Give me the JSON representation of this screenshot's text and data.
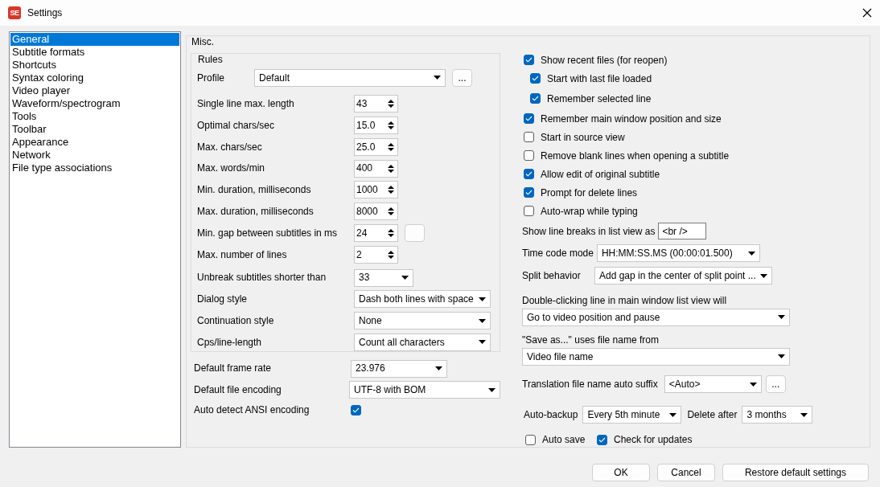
{
  "window": {
    "icon_text": "SE",
    "title": "Settings"
  },
  "sidebar": {
    "items": [
      {
        "label": "General",
        "selected": true
      },
      {
        "label": "Subtitle formats",
        "selected": false
      },
      {
        "label": "Shortcuts",
        "selected": false
      },
      {
        "label": "Syntax coloring",
        "selected": false
      },
      {
        "label": "Video player",
        "selected": false
      },
      {
        "label": "Waveform/spectrogram",
        "selected": false
      },
      {
        "label": "Tools",
        "selected": false
      },
      {
        "label": "Toolbar",
        "selected": false
      },
      {
        "label": "Appearance",
        "selected": false
      },
      {
        "label": "Network",
        "selected": false
      },
      {
        "label": "File type associations",
        "selected": false
      }
    ]
  },
  "misc": {
    "title": "Misc.",
    "rules": {
      "title": "Rules",
      "profile": {
        "label": "Profile",
        "value": "Default",
        "button": "..."
      },
      "fields": [
        {
          "kind": "spinner",
          "label": "Single line max. length",
          "value": "43"
        },
        {
          "kind": "spinner",
          "label": "Optimal chars/sec",
          "value": "15.0"
        },
        {
          "kind": "spinner",
          "label": "Max. chars/sec",
          "value": "25.0"
        },
        {
          "kind": "spinner",
          "label": "Max. words/min",
          "value": "400"
        },
        {
          "kind": "spinner",
          "label": "Min. duration, milliseconds",
          "value": "1000"
        },
        {
          "kind": "spinner",
          "label": "Max. duration, milliseconds",
          "value": "8000"
        },
        {
          "kind": "spinner",
          "label": "Min. gap between subtitles in ms",
          "value": "24",
          "side_button": true
        },
        {
          "kind": "spinner",
          "label": "Max. number of lines",
          "value": "2"
        },
        {
          "kind": "combo",
          "label": "Unbreak subtitles shorter than",
          "value": "33"
        },
        {
          "kind": "combo",
          "label": "Dialog style",
          "value": "Dash both lines with space"
        },
        {
          "kind": "combo",
          "label": "Continuation style",
          "value": "None"
        },
        {
          "kind": "combo",
          "label": "Cps/line-length",
          "value": "Count all characters"
        }
      ]
    },
    "general_fields": [
      {
        "kind": "combo",
        "label": "Default frame rate",
        "value": "23.976"
      },
      {
        "kind": "combo",
        "label": "Default file encoding",
        "value": "UTF-8 with BOM"
      },
      {
        "kind": "checkbox",
        "label": "Auto detect ANSI encoding",
        "checked": true
      }
    ],
    "options": [
      {
        "label": "Show recent files (for reopen)",
        "checked": true,
        "children": [
          {
            "label": "Start with last file loaded",
            "checked": true
          },
          {
            "label": "Remember selected line",
            "checked": true
          }
        ]
      },
      {
        "label": "Remember main window position and size",
        "checked": true
      },
      {
        "label": "Start in source view",
        "checked": false
      },
      {
        "label": "Remove blank lines when opening a subtitle",
        "checked": false
      },
      {
        "label": "Allow edit of original subtitle",
        "checked": true
      },
      {
        "label": "Prompt for delete lines",
        "checked": true
      },
      {
        "label": "Auto-wrap while typing",
        "checked": false
      }
    ],
    "line_breaks": {
      "label": "Show line breaks in list view as",
      "value": "<br />"
    },
    "time_code_mode": {
      "label": "Time code mode",
      "value": "HH:MM:SS.MS (00:00:01.500)"
    },
    "split_behavior": {
      "label": "Split behavior",
      "value": "Add gap in the center of split point ..."
    },
    "double_click": {
      "label": "Double-clicking line in main window list view will",
      "value": "Go to video position and pause"
    },
    "save_as": {
      "label": "\"Save as...\" uses file name from",
      "value": "Video file name"
    },
    "translation_suffix": {
      "label": "Translation file name auto suffix",
      "value": "<Auto>",
      "button": "..."
    },
    "auto_backup": {
      "label": "Auto-backup",
      "value": "Every 5th minute"
    },
    "delete_after": {
      "label": "Delete after",
      "value": "3 months"
    },
    "auto_save": {
      "label": "Auto save",
      "checked": false
    },
    "check_updates": {
      "label": "Check for updates",
      "checked": true
    }
  },
  "buttons": [
    {
      "label": "OK"
    },
    {
      "label": "Cancel"
    },
    {
      "label": "Restore default settings"
    }
  ]
}
